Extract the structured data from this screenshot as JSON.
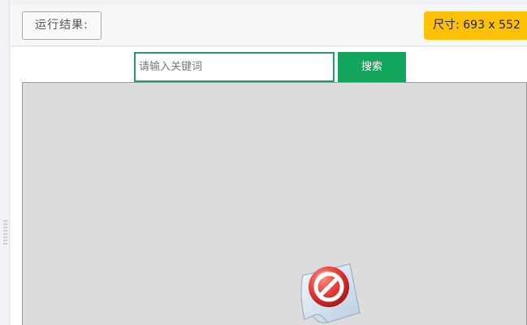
{
  "toolbar": {
    "result_label": "运行结果:",
    "size_label": "尺寸: 693 x 552"
  },
  "search": {
    "placeholder": "请输入关键词",
    "value": "",
    "button_label": "搜索"
  },
  "preview": {
    "status_icon": "blocked-plugin-icon"
  },
  "colors": {
    "accent_green": "#12a55c",
    "input_border": "#1f9d6a",
    "badge_yellow": "#ffc107",
    "frame_bg": "#dcdcdc"
  }
}
